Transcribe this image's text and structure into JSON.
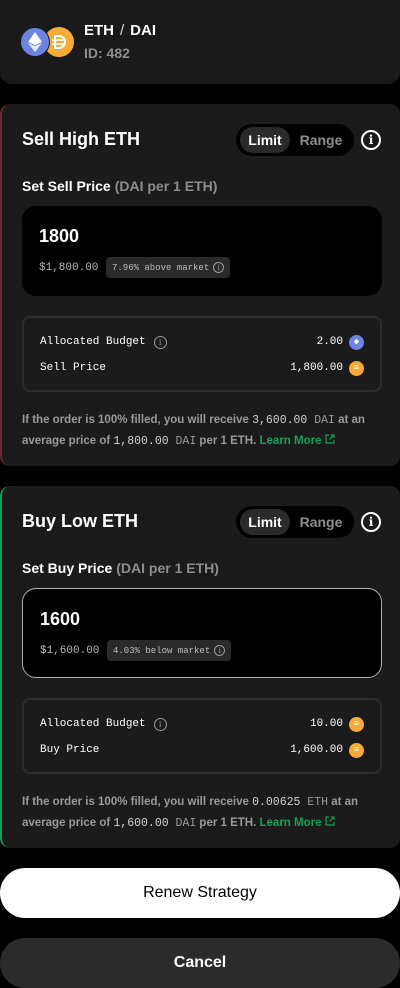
{
  "pair": {
    "base": "ETH",
    "separator": "/",
    "quote": "DAI",
    "id_text": "ID: 482",
    "icons": [
      "eth-icon",
      "dai-icon"
    ]
  },
  "sell": {
    "title": "Sell High ETH",
    "toggle": {
      "limit": "Limit",
      "range": "Range"
    },
    "set_label": "Set Sell Price",
    "set_unit": "(DAI per 1 ETH)",
    "price": "1800",
    "price_usd": "$1,800.00",
    "market_chip": "7.96% above market",
    "budget_label": "Allocated Budget",
    "budget_value": "2.00",
    "price_label": "Sell Price",
    "price_row_value": "1,800.00",
    "summary": {
      "p1": "If the order is 100% filled, you will receive ",
      "amount": "3,600.00",
      "amount_unit": " DAI",
      "p2": " at an average price of ",
      "avg": "1,800.00",
      "avg_unit": " DAI",
      "p3": " per 1 ETH. ",
      "learn": "Learn More"
    }
  },
  "buy": {
    "title": "Buy Low ETH",
    "toggle": {
      "limit": "Limit",
      "range": "Range"
    },
    "set_label": "Set Buy Price",
    "set_unit": "(DAI per 1 ETH)",
    "price": "1600",
    "price_usd": "$1,600.00",
    "market_chip": "4.03% below market",
    "budget_label": "Allocated Budget",
    "budget_value": "10.00",
    "price_label": "Buy Price",
    "price_row_value": "1,600.00",
    "summary": {
      "p1": "If the order is 100% filled, you will receive ",
      "amount": "0.00625",
      "amount_unit": " ETH",
      "p2": " at an average price of ",
      "avg": "1,600.00",
      "avg_unit": " DAI",
      "p3": " per 1 ETH. ",
      "learn": "Learn More"
    }
  },
  "actions": {
    "renew": "Renew Strategy",
    "cancel": "Cancel"
  },
  "colors": {
    "eth": "#6c84e0",
    "dai": "#f5ac37",
    "sell_accent": "#6b2a31",
    "buy_accent": "#13a05a",
    "learn_link": "#13a05a"
  }
}
